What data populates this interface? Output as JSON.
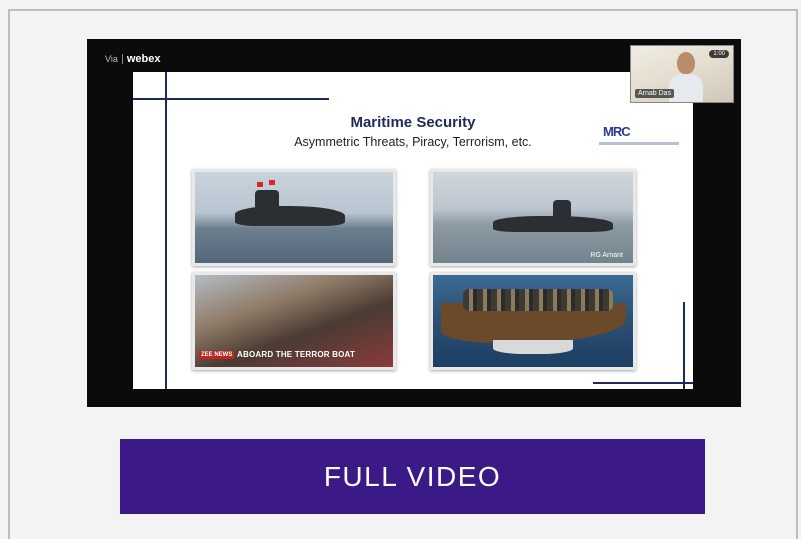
{
  "webex_bar": {
    "via_label": "Via",
    "brand_label": "webex"
  },
  "slide": {
    "title": "Maritime Security",
    "subtitle": "Asymmetric Threats, Piracy, Terrorism, etc.",
    "logo_text": "MRC",
    "images": [
      {
        "id": "submarine-chinese",
        "caption": ""
      },
      {
        "id": "submarine-indian",
        "credit": "RG Arnant"
      },
      {
        "id": "terror-boat",
        "tag": "ZEE NEWS",
        "caption": "ABOARD THE TERROR BOAT"
      },
      {
        "id": "pirates-dhow",
        "caption": ""
      }
    ]
  },
  "camera_tile": {
    "participant_name": "Arnab Das",
    "badge": "1:00"
  },
  "cta": {
    "full_video_label": "FULL VIDEO"
  },
  "colors": {
    "cta_background": "#3b1a87",
    "slide_accent": "#1f2a5a"
  }
}
